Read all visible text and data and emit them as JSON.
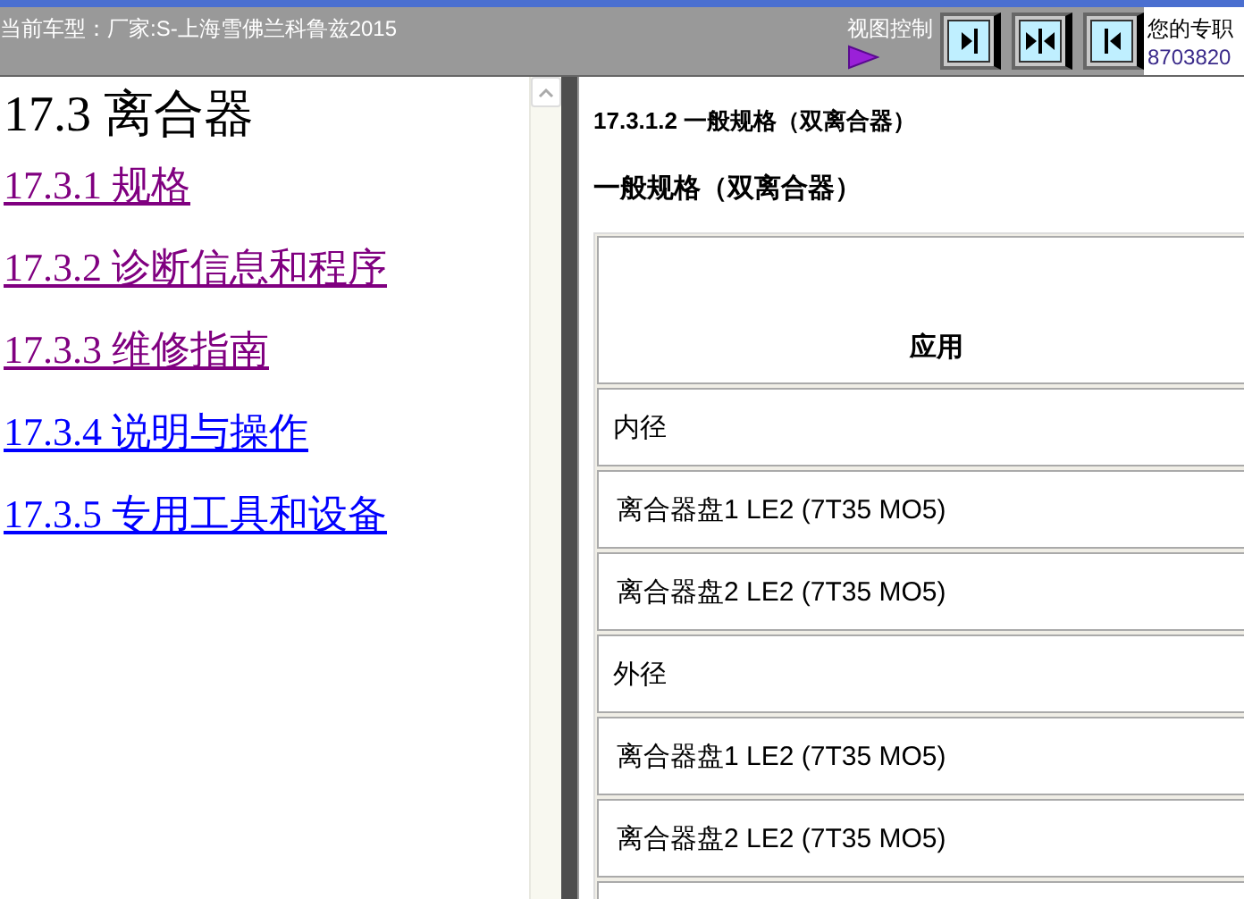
{
  "top_bar": {
    "vehicle": "当前车型：厂家:S-上海雪佛兰科鲁兹2015",
    "view_control_label": "视图控制",
    "view_buttons": [
      {
        "kind": "right"
      },
      {
        "kind": "both"
      },
      {
        "kind": "left"
      }
    ],
    "contact_label": "您的专职",
    "contact_number": "8703820"
  },
  "toc": {
    "title": "17.3 离合器",
    "links": [
      {
        "label": "17.3.1 规格",
        "visited": true
      },
      {
        "label": "17.3.2 诊断信息和程序",
        "visited": true
      },
      {
        "label": "17.3.3 维修指南",
        "visited": true
      },
      {
        "label": "17.3.4 说明与操作",
        "visited": false
      },
      {
        "label": "17.3.5 专用工具和设备",
        "visited": false
      }
    ]
  },
  "content": {
    "heading": "17.3.1.2 一般规格（双离合器）",
    "subheading": "一般规格（双离合器）",
    "table": {
      "columns": [
        "应用"
      ],
      "rows": [
        {
          "kind": "group",
          "text": "内径"
        },
        {
          "kind": "item",
          "text": "离合器盘1 LE2 (7T35 MO5)"
        },
        {
          "kind": "item",
          "text": "离合器盘2 LE2 (7T35 MO5)"
        },
        {
          "kind": "group",
          "text": "外径"
        },
        {
          "kind": "item",
          "text": "离合器盘1 LE2 (7T35 MO5)"
        },
        {
          "kind": "item",
          "text": "离合器盘2 LE2 (7T35 MO5)"
        }
      ]
    }
  }
}
